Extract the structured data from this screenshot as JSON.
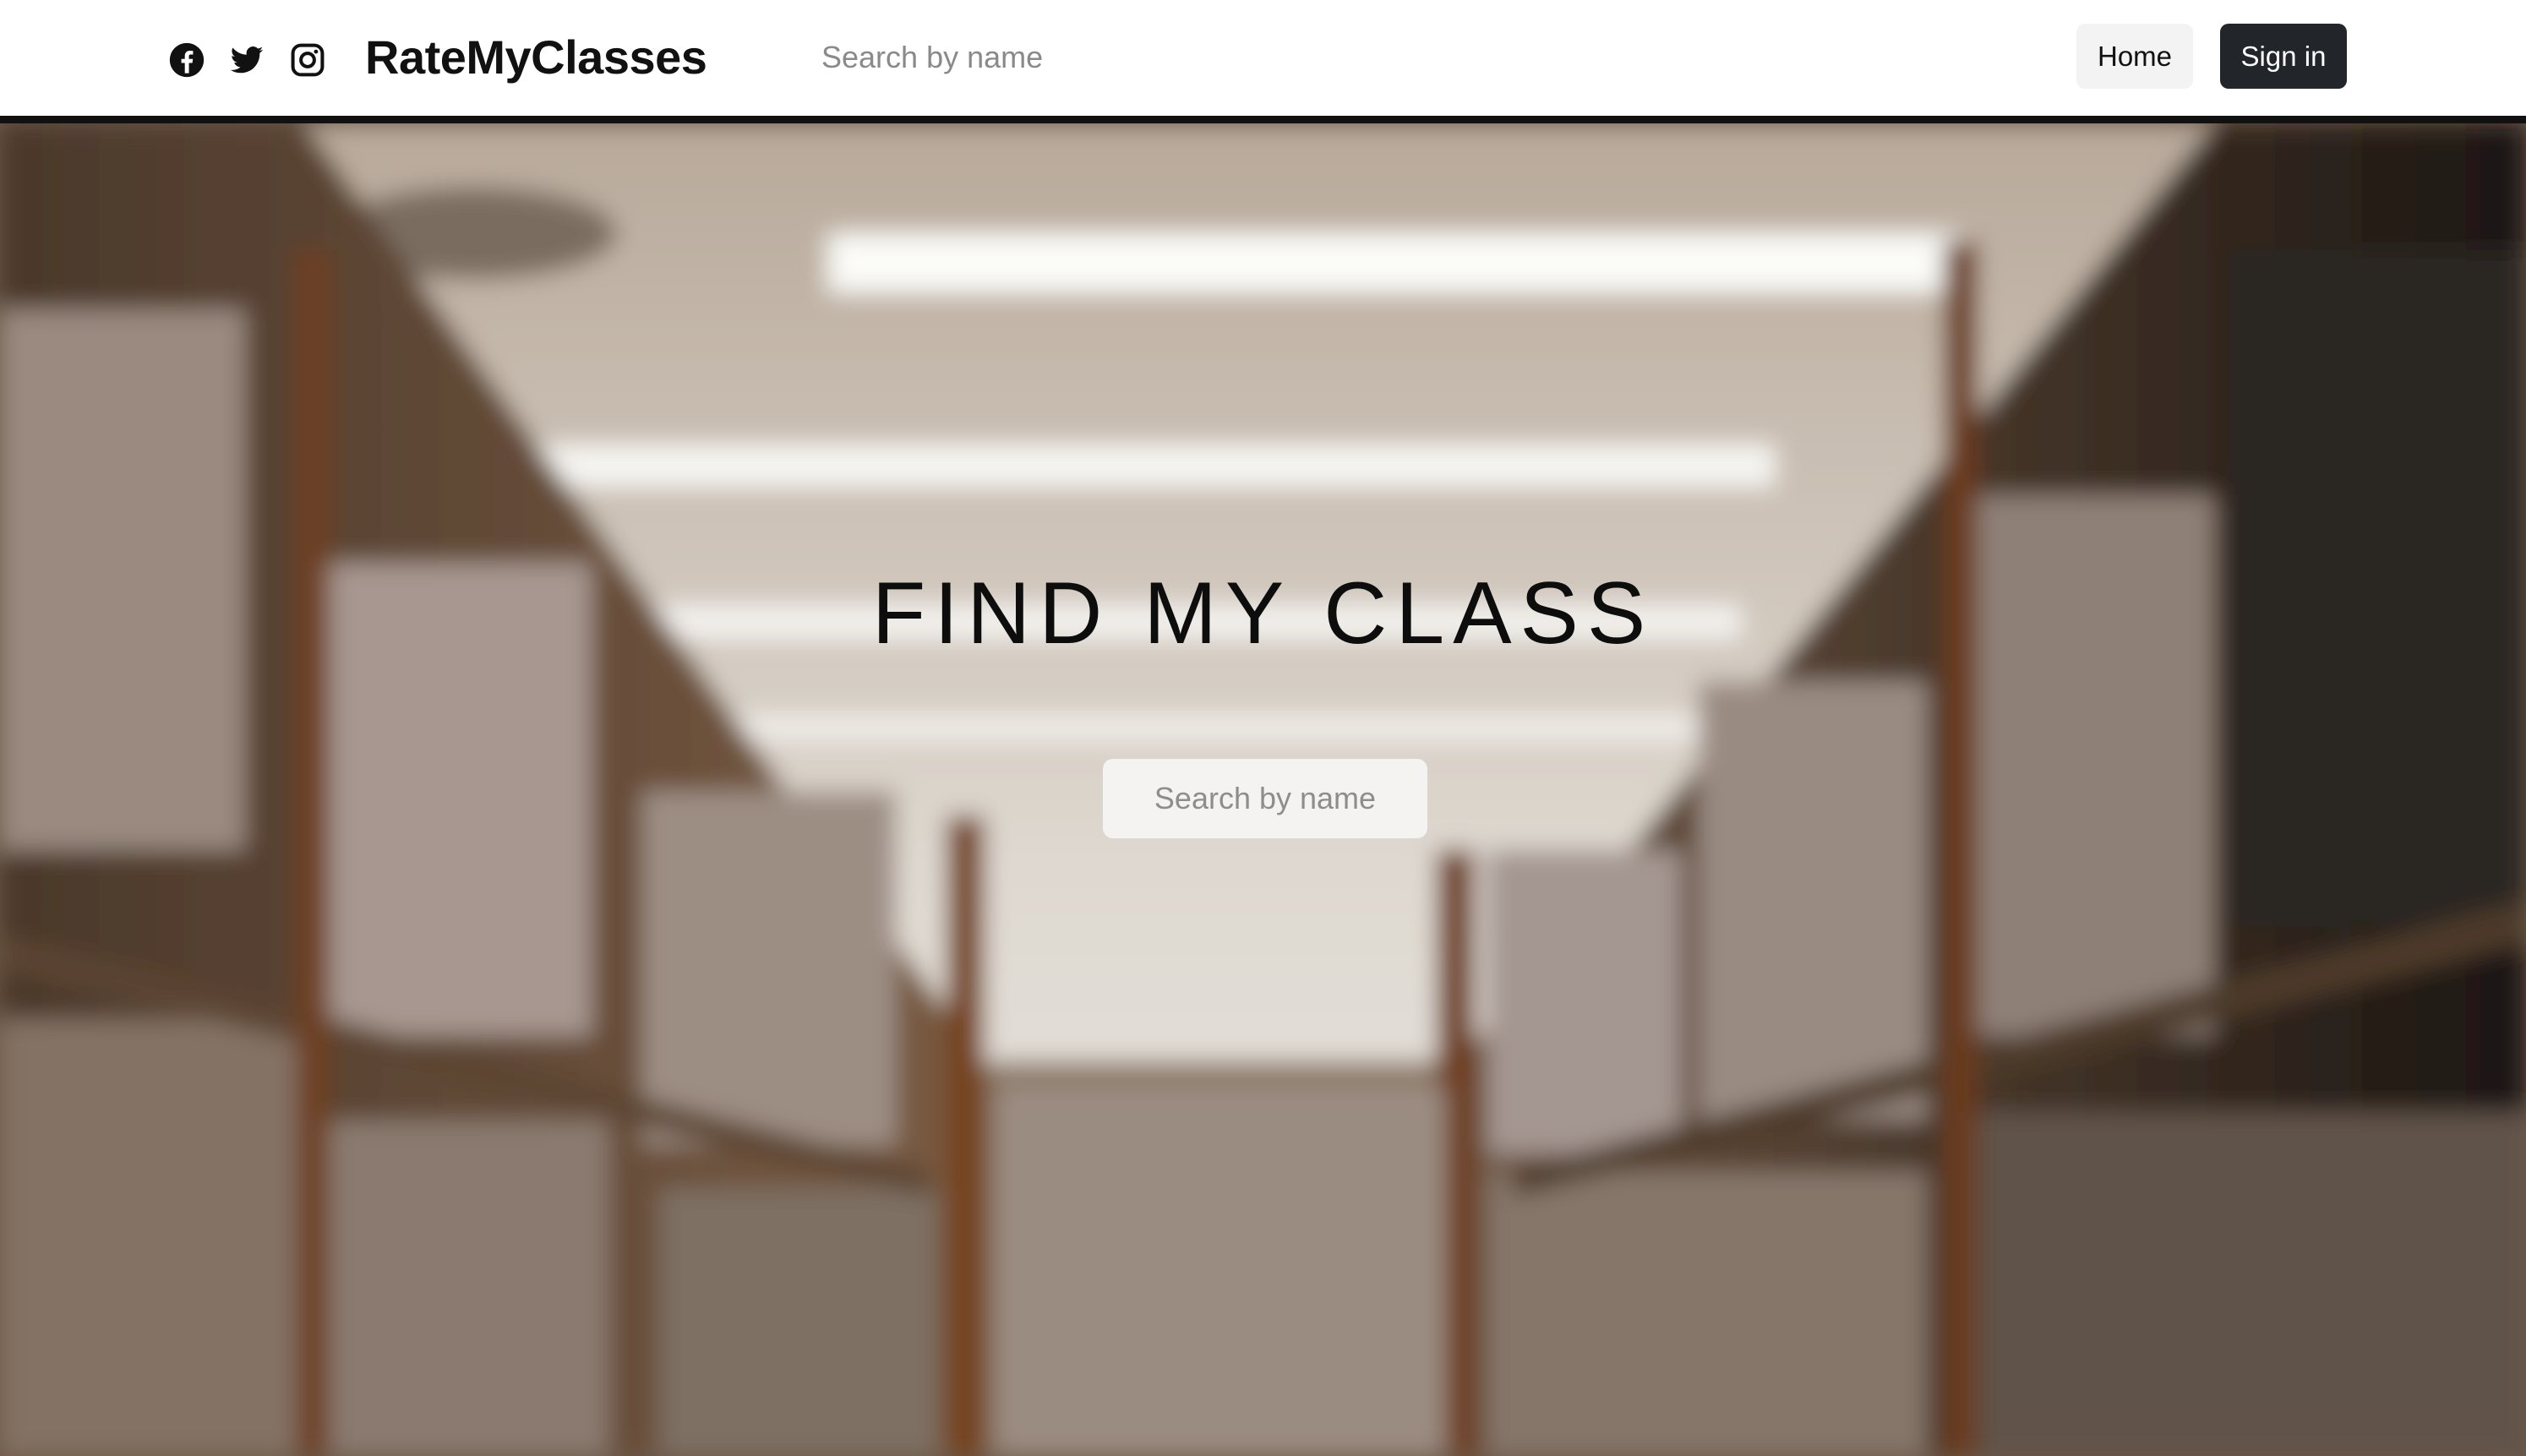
{
  "header": {
    "brand": "RateMyClasses",
    "search_placeholder": "Search by name",
    "home_label": "Home",
    "signin_label": "Sign in",
    "social_icons": [
      "facebook-icon",
      "twitter-icon",
      "instagram-icon"
    ]
  },
  "hero": {
    "title": "FIND MY CLASS",
    "search_placeholder": "Search by name",
    "background": "blurred library aisle with bookshelves"
  },
  "colors": {
    "header_bg": "#ffffff",
    "header_border": "#111111",
    "signin_bg": "#22262b",
    "home_bg": "#f3f3f3",
    "title_text": "#0d0d0d"
  }
}
